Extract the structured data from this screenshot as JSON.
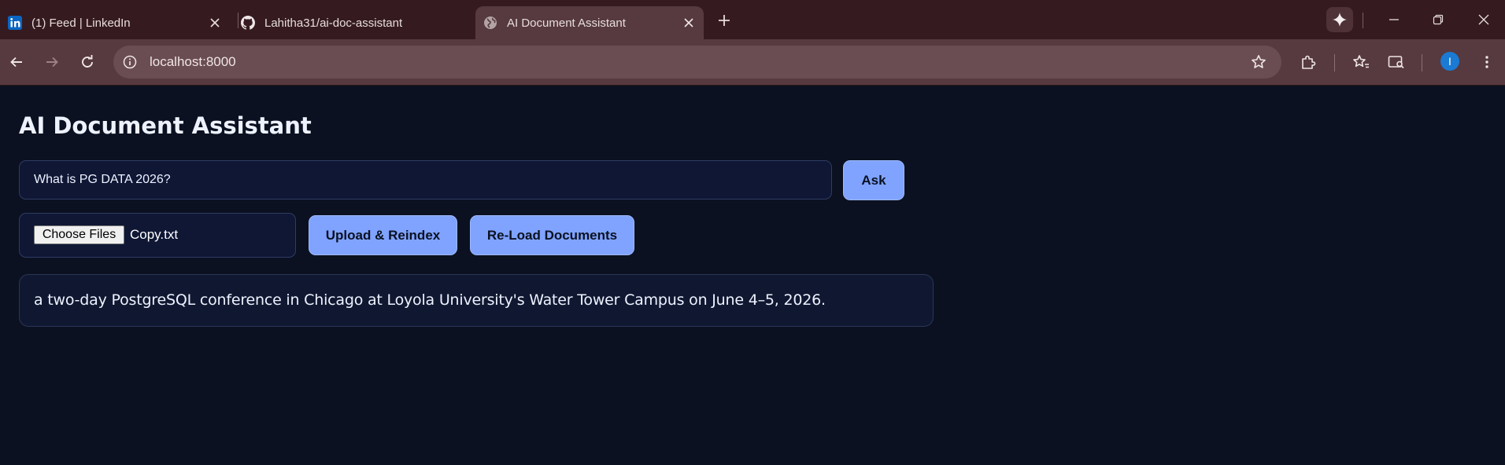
{
  "browser": {
    "tabs": [
      {
        "title": "(1) Feed | LinkedIn",
        "icon": "linkedin-icon",
        "active": false
      },
      {
        "title": "Lahitha31/ai-doc-assistant",
        "icon": "github-icon",
        "active": false
      },
      {
        "title": "AI Document Assistant",
        "icon": "globe-icon",
        "active": true
      }
    ],
    "url": "localhost:8000",
    "profile_initial": "I",
    "colors": {
      "tabbar": "#351b20",
      "toolbar": "#563a3f",
      "profile": "#1a7ad4"
    }
  },
  "app": {
    "title": "AI Document Assistant",
    "question_value": "What is PG DATA 2026?",
    "ask_label": "Ask",
    "choose_files_label": "Choose Files",
    "selected_file": "Copy.txt",
    "upload_label": "Upload & Reindex",
    "reload_label": "Re-Load Documents",
    "answer": "a two-day PostgreSQL conference in Chicago at Loyola University's Water Tower Campus on June 4–5, 2026.",
    "colors": {
      "background": "#0b1120",
      "accent": "#7fa3ff",
      "panel": "#0f1735"
    }
  }
}
